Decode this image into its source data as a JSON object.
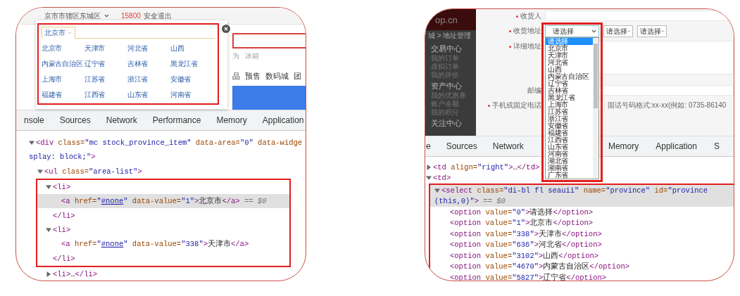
{
  "left": {
    "page": {
      "location": "京市市辖区东城区",
      "points": "15800",
      "logout": "安全退出",
      "popup": {
        "tab": "北京市",
        "areas": [
          "北京市",
          "天津市",
          "河北省",
          "山西",
          "内蒙古自治区",
          "辽宁省",
          "吉林省",
          "黑龙江省",
          "上海市",
          "江苏省",
          "浙江省",
          "安徽省",
          "福建省",
          "江西省",
          "山东省",
          "河南省"
        ]
      },
      "hot_words": [
        "为",
        "冰箱"
      ],
      "nav": [
        "品",
        "预售",
        "数码城",
        "团"
      ]
    },
    "devtools": {
      "tabs": [
        "nsole",
        "Sources",
        "Network",
        "Performance",
        "Memory",
        "Application"
      ],
      "tree": [
        {
          "expanded": true,
          "selected": false,
          "boxed": false,
          "lines": [
            [
              {
                "kind": "tag",
                "text": "<div"
              },
              {
                "kind": "attr",
                "text": " class="
              },
              {
                "kind": "value",
                "text": "\"mc stock_province_item\""
              },
              {
                "kind": "attr",
                "text": " data-area="
              },
              {
                "kind": "value",
                "text": "\"0\""
              },
              {
                "kind": "attr",
                "text": " data-widge"
              }
            ],
            [
              {
                "kind": "value",
                "text": "splay: block;\""
              },
              {
                "kind": "tag",
                "text": ">"
              }
            ]
          ],
          "children": [
            {
              "expanded": true,
              "selected": false,
              "boxed": false,
              "lines": [
                [
                  {
                    "kind": "tag",
                    "text": "<ul"
                  },
                  {
                    "kind": "attr",
                    "text": " class="
                  },
                  {
                    "kind": "value",
                    "text": "\"area-list\""
                  },
                  {
                    "kind": "tag",
                    "text": ">"
                  }
                ]
              ],
              "children": [
                {
                  "expanded": true,
                  "selected": false,
                  "boxed": true,
                  "lines": [
                    [
                      {
                        "kind": "tag",
                        "text": "<li>"
                      }
                    ]
                  ],
                  "closing": [
                    {
                      "kind": "tag",
                      "text": "</li>"
                    }
                  ],
                  "children": [
                    {
                      "selected": true,
                      "lines": [
                        [
                          {
                            "kind": "tag",
                            "text": "<a"
                          },
                          {
                            "kind": "attr",
                            "text": " href="
                          },
                          {
                            "kind": "value",
                            "text": "\""
                          },
                          {
                            "kind": "link",
                            "text": "#none"
                          },
                          {
                            "kind": "value",
                            "text": "\""
                          },
                          {
                            "kind": "attr",
                            "text": " data-value="
                          },
                          {
                            "kind": "value",
                            "text": "\"1\""
                          },
                          {
                            "kind": "tag",
                            "text": ">"
                          },
                          {
                            "kind": "text",
                            "text": "北京市"
                          },
                          {
                            "kind": "tag",
                            "text": "</a>"
                          },
                          {
                            "kind": "comment",
                            "text": " == $0"
                          }
                        ]
                      ]
                    }
                  ]
                },
                {
                  "expanded": true,
                  "selected": false,
                  "boxed": true,
                  "lines": [
                    [
                      {
                        "kind": "tag",
                        "text": "<li>"
                      }
                    ]
                  ],
                  "closing": [
                    {
                      "kind": "tag",
                      "text": "</li>"
                    }
                  ],
                  "children": [
                    {
                      "selected": false,
                      "lines": [
                        [
                          {
                            "kind": "tag",
                            "text": "<a"
                          },
                          {
                            "kind": "attr",
                            "text": " href="
                          },
                          {
                            "kind": "value",
                            "text": "\""
                          },
                          {
                            "kind": "link",
                            "text": "#none"
                          },
                          {
                            "kind": "value",
                            "text": "\""
                          },
                          {
                            "kind": "attr",
                            "text": " data-value="
                          },
                          {
                            "kind": "value",
                            "text": "\"338\""
                          },
                          {
                            "kind": "tag",
                            "text": ">"
                          },
                          {
                            "kind": "text",
                            "text": "天津市"
                          },
                          {
                            "kind": "tag",
                            "text": "</a>"
                          }
                        ]
                      ]
                    }
                  ]
                },
                {
                  "expanded": false,
                  "selected": false,
                  "boxed": false,
                  "lines": [
                    [
                      {
                        "kind": "tag",
                        "text": "<li>"
                      },
                      {
                        "kind": "text",
                        "text": "…"
                      },
                      {
                        "kind": "tag",
                        "text": "</li>"
                      }
                    ]
                  ]
                }
              ]
            }
          ]
        }
      ]
    }
  },
  "right": {
    "sidebar": {
      "logo": "op.cn",
      "breadcrumb": "城 > 地址管理",
      "items": [
        {
          "kind": "heading",
          "label": "交易中心"
        },
        {
          "kind": "link",
          "label": "我的订单"
        },
        {
          "kind": "link",
          "label": "虚拟订单"
        },
        {
          "kind": "link",
          "label": "我的评价"
        },
        {
          "kind": "heading",
          "label": "资产中心"
        },
        {
          "kind": "link",
          "label": "我的优惠券"
        },
        {
          "kind": "link",
          "label": "账户余额"
        },
        {
          "kind": "link",
          "label": "我的积分"
        },
        {
          "kind": "heading",
          "label": "关注中心"
        }
      ]
    },
    "form": {
      "rows": [
        {
          "kind": "text",
          "label": "收货人",
          "required": true
        },
        {
          "kind": "address",
          "label": "收货地址",
          "required": true,
          "selects": [
            "请选择",
            "请选择",
            "请选择"
          ],
          "options": [
            {
              "label": "请选择",
              "selected": true
            },
            {
              "label": "北京市",
              "selected": false
            },
            {
              "label": "天津市",
              "selected": false
            },
            {
              "label": "河北省",
              "selected": false
            },
            {
              "label": "山西",
              "selected": false
            },
            {
              "label": "内蒙古自治区",
              "selected": false
            },
            {
              "label": "辽宁省",
              "selected": false
            },
            {
              "label": "吉林省",
              "selected": false
            },
            {
              "label": "黑龙江省",
              "selected": false
            },
            {
              "label": "上海市",
              "selected": false
            },
            {
              "label": "江苏省",
              "selected": false
            },
            {
              "label": "浙江省",
              "selected": false
            },
            {
              "label": "安徽省",
              "selected": false
            },
            {
              "label": "福建省",
              "selected": false
            },
            {
              "label": "江西省",
              "selected": false
            },
            {
              "label": "山东省",
              "selected": false
            },
            {
              "label": "河南省",
              "selected": false
            },
            {
              "label": "湖北省",
              "selected": false
            },
            {
              "label": "湖南省",
              "selected": false
            },
            {
              "label": "广东省",
              "selected": false
            }
          ]
        },
        {
          "kind": "textarea",
          "label": "详细地址",
          "required": true
        },
        {
          "kind": "text",
          "label": "邮编",
          "required": false
        },
        {
          "kind": "phone",
          "label": "手机或固定电话",
          "required": true,
          "hint": "固话号码格式:xx-xx(例如: 0735-86140"
        }
      ]
    },
    "devtools": {
      "tabs": [
        "e",
        "Sources",
        "Network"
      ],
      "tabs_after_dropdown": [
        "Memory",
        "Application",
        "S"
      ],
      "tree": [
        {
          "expanded": false,
          "selected": false,
          "boxed": false,
          "lines": [
            [
              {
                "kind": "tag",
                "text": "<td"
              },
              {
                "kind": "attr",
                "text": " align="
              },
              {
                "kind": "value",
                "text": "\"right\""
              },
              {
                "kind": "tag",
                "text": ">"
              },
              {
                "kind": "text",
                "text": "…"
              },
              {
                "kind": "tag",
                "text": "</td>"
              }
            ]
          ]
        },
        {
          "expanded": true,
          "selected": false,
          "boxed": false,
          "lines": [
            [
              {
                "kind": "tag",
                "text": "<td>"
              }
            ]
          ],
          "children": [
            {
              "expanded": true,
              "selected": true,
              "boxed": true,
              "lines": [
                [
                  {
                    "kind": "tag",
                    "text": "<select"
                  },
                  {
                    "kind": "attr",
                    "text": " class="
                  },
                  {
                    "kind": "value",
                    "text": "\"di-bl fl seauii\""
                  },
                  {
                    "kind": "attr",
                    "text": " name="
                  },
                  {
                    "kind": "value",
                    "text": "\"province\""
                  },
                  {
                    "kind": "attr",
                    "text": " id="
                  },
                  {
                    "kind": "value",
                    "text": "\"province"
                  }
                ],
                [
                  {
                    "kind": "value",
                    "text": "(this,0)\""
                  },
                  {
                    "kind": "tag",
                    "text": ">"
                  },
                  {
                    "kind": "comment",
                    "text": " == $0"
                  }
                ]
              ],
              "children": [
                {
                  "selected": false,
                  "lines": [
                    [
                      {
                        "kind": "tag",
                        "text": "<option"
                      },
                      {
                        "kind": "attr",
                        "text": " value="
                      },
                      {
                        "kind": "value",
                        "text": "\"0\""
                      },
                      {
                        "kind": "tag",
                        "text": ">"
                      },
                      {
                        "kind": "text",
                        "text": "请选择"
                      },
                      {
                        "kind": "tag",
                        "text": "</option>"
                      }
                    ]
                  ]
                },
                {
                  "selected": false,
                  "lines": [
                    [
                      {
                        "kind": "tag",
                        "text": "<option"
                      },
                      {
                        "kind": "attr",
                        "text": " value="
                      },
                      {
                        "kind": "value",
                        "text": "\"1\""
                      },
                      {
                        "kind": "tag",
                        "text": ">"
                      },
                      {
                        "kind": "text",
                        "text": "北京市"
                      },
                      {
                        "kind": "tag",
                        "text": "</option>"
                      }
                    ]
                  ]
                },
                {
                  "selected": false,
                  "lines": [
                    [
                      {
                        "kind": "tag",
                        "text": "<option"
                      },
                      {
                        "kind": "attr",
                        "text": " value="
                      },
                      {
                        "kind": "value",
                        "text": "\"338\""
                      },
                      {
                        "kind": "tag",
                        "text": ">"
                      },
                      {
                        "kind": "text",
                        "text": "天津市"
                      },
                      {
                        "kind": "tag",
                        "text": "</option>"
                      }
                    ]
                  ]
                },
                {
                  "selected": false,
                  "lines": [
                    [
                      {
                        "kind": "tag",
                        "text": "<option"
                      },
                      {
                        "kind": "attr",
                        "text": " value="
                      },
                      {
                        "kind": "value",
                        "text": "\"636\""
                      },
                      {
                        "kind": "tag",
                        "text": ">"
                      },
                      {
                        "kind": "text",
                        "text": "河北省"
                      },
                      {
                        "kind": "tag",
                        "text": "</option>"
                      }
                    ]
                  ]
                },
                {
                  "selected": false,
                  "lines": [
                    [
                      {
                        "kind": "tag",
                        "text": "<option"
                      },
                      {
                        "kind": "attr",
                        "text": " value="
                      },
                      {
                        "kind": "value",
                        "text": "\"3102\""
                      },
                      {
                        "kind": "tag",
                        "text": ">"
                      },
                      {
                        "kind": "text",
                        "text": "山西"
                      },
                      {
                        "kind": "tag",
                        "text": "</option>"
                      }
                    ]
                  ]
                },
                {
                  "selected": false,
                  "lines": [
                    [
                      {
                        "kind": "tag",
                        "text": "<option"
                      },
                      {
                        "kind": "attr",
                        "text": " value="
                      },
                      {
                        "kind": "value",
                        "text": "\"4670\""
                      },
                      {
                        "kind": "tag",
                        "text": ">"
                      },
                      {
                        "kind": "text",
                        "text": "内蒙古自治区"
                      },
                      {
                        "kind": "tag",
                        "text": "</option>"
                      }
                    ]
                  ]
                },
                {
                  "selected": false,
                  "lines": [
                    [
                      {
                        "kind": "tag",
                        "text": "<option"
                      },
                      {
                        "kind": "attr",
                        "text": " value="
                      },
                      {
                        "kind": "value",
                        "text": "\"5827\""
                      },
                      {
                        "kind": "tag",
                        "text": ">"
                      },
                      {
                        "kind": "text",
                        "text": "辽宁省"
                      },
                      {
                        "kind": "tag",
                        "text": "</option>"
                      }
                    ]
                  ]
                }
              ]
            }
          ]
        }
      ]
    }
  }
}
